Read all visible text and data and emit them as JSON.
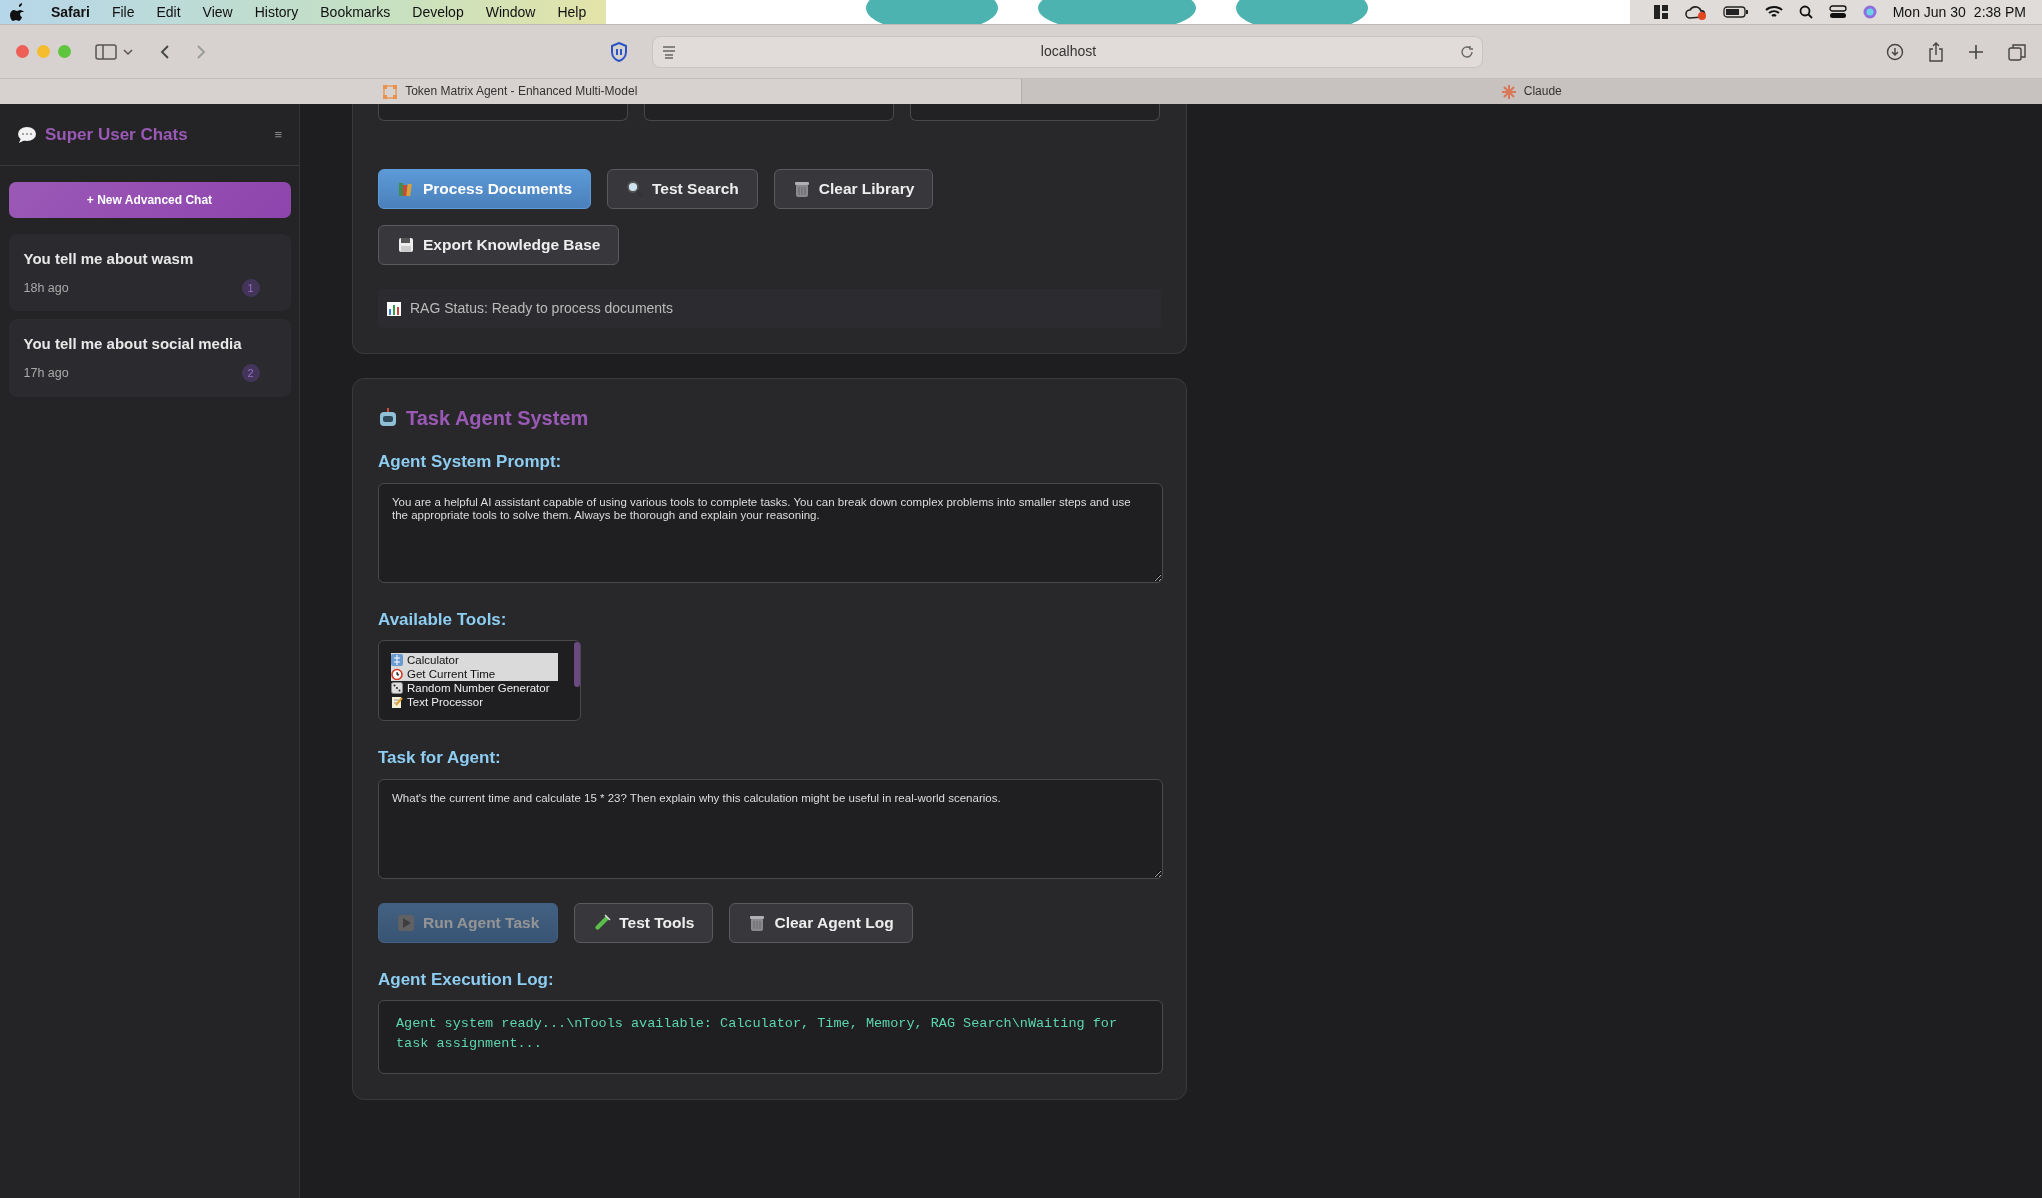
{
  "menu_bar": {
    "app": "Safari",
    "items": [
      "File",
      "Edit",
      "View",
      "History",
      "Bookmarks",
      "Develop",
      "Window",
      "Help"
    ],
    "date": "Mon Jun 30",
    "time": "2:38 PM"
  },
  "browser": {
    "address": "localhost",
    "tabs": [
      {
        "title": "Token Matrix Agent - Enhanced Multi-Model",
        "selected": true
      },
      {
        "title": "Claude",
        "selected": false
      }
    ]
  },
  "sidebar": {
    "title": "Super User Chats",
    "toggle": "≡",
    "new_chat": "+ New Advanced Chat",
    "chats": [
      {
        "title": "You tell me about wasm",
        "time": "18h ago",
        "count": "1"
      },
      {
        "title": "You tell me about social media",
        "time": "17h ago",
        "count": "2"
      }
    ]
  },
  "rag_panel": {
    "buttons": [
      {
        "label": "Process Documents",
        "kind": "primary",
        "disabled": false
      },
      {
        "label": "Test Search",
        "kind": "secondary",
        "disabled": false
      },
      {
        "label": "Clear Library",
        "kind": "secondary",
        "disabled": false
      },
      {
        "label": "Export Knowledge Base",
        "kind": "secondary",
        "disabled": false
      }
    ],
    "status": "RAG Status: Ready to process documents"
  },
  "agent_panel": {
    "title": "Task Agent System",
    "prompt_label": "Agent System Prompt:",
    "prompt": "You are a helpful AI assistant capable of using various tools to complete tasks. You can break down complex problems into smaller steps and use the appropriate tools to solve them. Always be thorough and explain your reasoning.",
    "tools_label": "Available Tools:",
    "tools": [
      {
        "label": "Calculator",
        "selected": true
      },
      {
        "label": "Get Current Time",
        "selected": true
      },
      {
        "label": "Random Number Generator",
        "selected": false
      },
      {
        "label": "Text Processor",
        "selected": false
      }
    ],
    "task_label": "Task for Agent:",
    "task": "What's the current time and calculate 15 * 23? Then explain why this calculation might be useful in real-world scenarios.",
    "buttons": [
      {
        "label": "Run Agent Task",
        "kind": "primary",
        "disabled": true
      },
      {
        "label": "Test Tools",
        "kind": "secondary",
        "disabled": false
      },
      {
        "label": "Clear Agent Log",
        "kind": "secondary",
        "disabled": false
      }
    ],
    "log_label": "Agent Execution Log:",
    "log": "Agent system ready...\\nTools available: Calculator, Time, Memory, RAG Search\\nWaiting for task assignment..."
  }
}
